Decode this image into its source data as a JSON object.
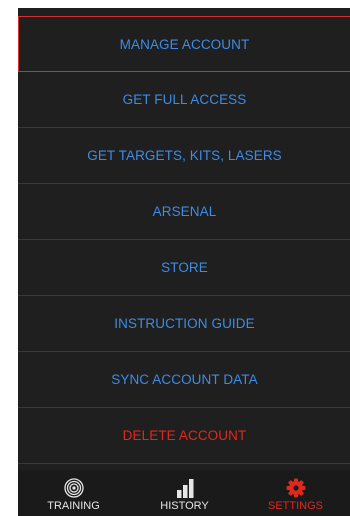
{
  "menu": {
    "items": [
      {
        "label": "MANAGE ACCOUNT"
      },
      {
        "label": "GET FULL ACCESS"
      },
      {
        "label": "GET TARGETS, KITS, LASERS"
      },
      {
        "label": "ARSENAL"
      },
      {
        "label": "STORE"
      },
      {
        "label": "INSTRUCTION GUIDE"
      },
      {
        "label": "SYNC ACCOUNT DATA"
      },
      {
        "label": "DELETE ACCOUNT"
      }
    ]
  },
  "tabbar": {
    "tabs": [
      {
        "label": "TRAINING",
        "icon": "target-icon"
      },
      {
        "label": "HISTORY",
        "icon": "bar-chart-icon"
      },
      {
        "label": "SETTINGS",
        "icon": "gear-icon",
        "active": true
      }
    ]
  },
  "colors": {
    "background": "#1f1f1f",
    "link_blue": "#3c8ce8",
    "danger_red": "#e0281e",
    "selected_border": "#d32f2f",
    "divider": "#3a3a3a"
  }
}
